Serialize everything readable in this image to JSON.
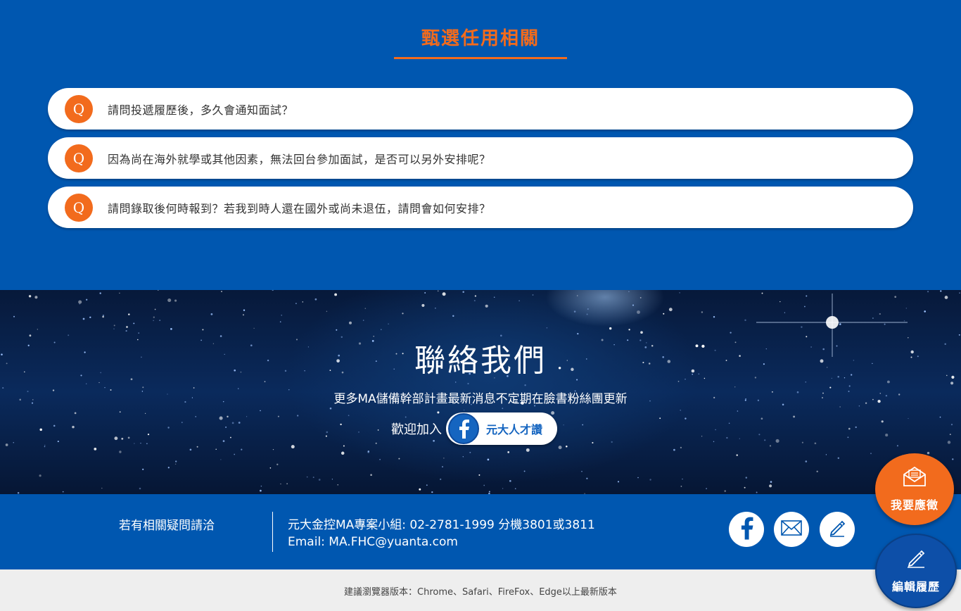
{
  "faq": {
    "title": "甄選任用相關",
    "badge": "Q",
    "items": [
      {
        "question": "請問投遞履歷後，多久會通知面試？"
      },
      {
        "question": "因為尚在海外就學或其他因素，無法回台參加面試，是否可以另外安排呢？"
      },
      {
        "question": "請問錄取後何時報到？若我到時人還在國外或尚未退伍，請問會如何安排？"
      }
    ],
    "accent_color": "#f26b1d"
  },
  "contact": {
    "title": "聯絡我們",
    "subtitle": "更多MA儲備幹部計畫最新消息不定期在臉書粉絲團更新",
    "join_label": "歡迎加入",
    "fb_page_label": "元大人才讚",
    "fb_icon": "facebook-icon"
  },
  "info": {
    "left_label": "若有相關疑問請洽",
    "phone_line": "元大金控MA專案小組: 02-2781-1999 分機3801或3811",
    "email_line": "Email: MA.FHC@yuanta.com",
    "social_icons": [
      "facebook-icon",
      "mail-icon",
      "pencil-icon"
    ]
  },
  "footer": {
    "browser_note": "建議瀏覽器版本：Chrome、Safari、FireFox、Edge以上最新版本"
  },
  "floating": {
    "apply_label": "我要應徵",
    "apply_icon": "envelope-open-icon",
    "edit_label": "編輯履歷",
    "edit_icon": "pencil-icon"
  },
  "colors": {
    "brand_blue": "#0057b0",
    "accent_orange": "#f26b1d",
    "footer_gray": "#eeeeee"
  }
}
